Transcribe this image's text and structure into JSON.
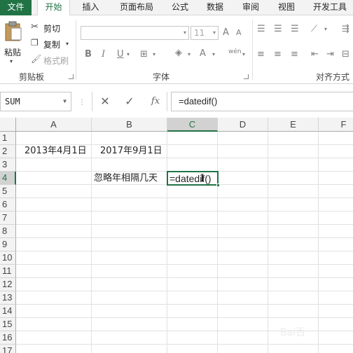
{
  "tabs": [
    {
      "label": "文件"
    },
    {
      "label": "开始"
    },
    {
      "label": "插入"
    },
    {
      "label": "页面布局"
    },
    {
      "label": "公式"
    },
    {
      "label": "数据"
    },
    {
      "label": "审阅"
    },
    {
      "label": "视图"
    },
    {
      "label": "开发工具"
    }
  ],
  "ribbon": {
    "clipboard": {
      "paste_label": "粘贴",
      "cut_label": "剪切",
      "copy_label": "复制",
      "format_painter_label": "格式刷",
      "group_label": "剪贴板"
    },
    "font": {
      "font_size_value": "11",
      "bold": "B",
      "italic": "I",
      "underline": "U",
      "grow": "A",
      "shrink": "A",
      "font_color": "A",
      "phonetic": "wén",
      "group_label": "字体"
    },
    "alignment": {
      "group_label": "对齐方式"
    }
  },
  "formula_bar": {
    "name_box": "SUM",
    "cancel_icon": "✕",
    "enter_icon": "✓",
    "fx_label": "fx",
    "formula": "=datedif()"
  },
  "sheet": {
    "columns": [
      "A",
      "B",
      "C",
      "D",
      "E",
      "F"
    ],
    "selected_column": "C",
    "rows": [
      "1",
      "2",
      "3",
      "4",
      "5",
      "6",
      "7",
      "8",
      "9",
      "10",
      "11",
      "12",
      "13",
      "14",
      "15",
      "16",
      "17"
    ],
    "selected_row": "4",
    "cells": {
      "A2": "2013年4月1日",
      "B2": "2017年9月1日",
      "B4": "忽略年相隔几天",
      "C4": "=datedif()"
    }
  },
  "colors": {
    "accent": "#217346",
    "grid": "#e1e1e1",
    "header_bg": "#f3f3f3"
  }
}
